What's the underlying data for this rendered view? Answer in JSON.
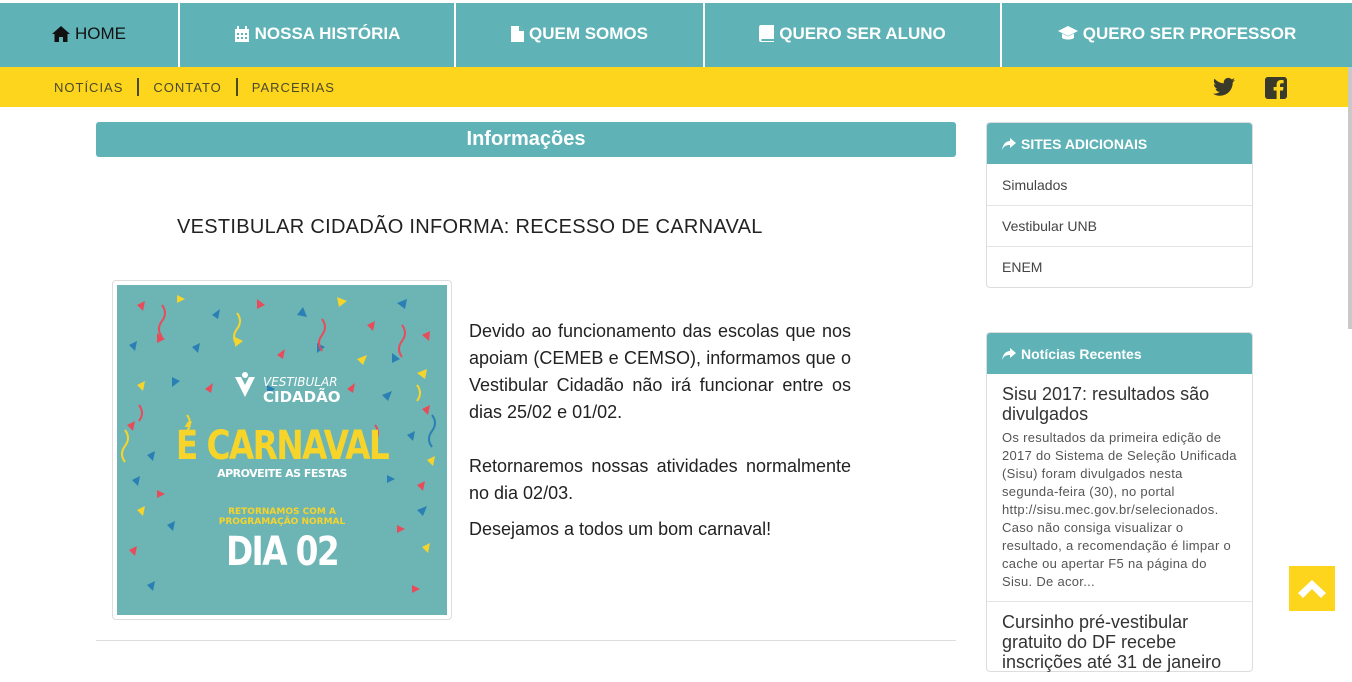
{
  "nav": {
    "items": [
      {
        "label": "HOME",
        "icon": "home-icon"
      },
      {
        "label": "NOSSA HISTÓRIA",
        "icon": "calendar-icon"
      },
      {
        "label": "QUEM SOMOS",
        "icon": "file-icon"
      },
      {
        "label": "QUERO SER ALUNO",
        "icon": "book-icon"
      },
      {
        "label": "QUERO SER PROFESSOR",
        "icon": "graduation-cap-icon"
      }
    ],
    "active": "HOME"
  },
  "subnav": {
    "links": [
      "NOTÍCIAS",
      "CONTATO",
      "PARCERIAS"
    ],
    "social_icons": [
      "twitter-icon",
      "facebook-icon"
    ]
  },
  "main": {
    "section_title": "Informações",
    "post_title": "VESTIBULAR CIDADÃO INFORMA: RECESSO DE CARNAVAL",
    "poster": {
      "logo_top": "VESTIBULAR",
      "logo_bottom": "CIDADÃO",
      "headline": "É CARNAVAL",
      "subline": "APROVEITE AS FESTAS",
      "return_line1": "RETORNAMOS COM A",
      "return_line2": "PROGRAMAÇÃO NORMAL",
      "day": "DIA 02"
    },
    "paragraphs": [
      "Devido ao funcionamento das escolas que nos apoiam (CEMEB e CEMSO), informamos que o Vestibular Cidadão não irá funcionar entre os dias 25/02 e 01/02.",
      "Retornaremos nossas atividades normalmente no dia 02/03.",
      "Desejamos a todos um bom carnaval!"
    ]
  },
  "sidebar": {
    "sites": {
      "title": "SITES ADICIONAIS",
      "links": [
        "Simulados",
        "Vestibular UNB",
        "ENEM"
      ]
    },
    "news": {
      "title": "Notícias Recentes",
      "items": [
        {
          "title": "Sisu 2017: resultados são divulgados",
          "excerpt": "Os resultados da primeira edição de 2017 do Sistema de Seleção Unificada (Sisu) foram divulgados nesta segunda-feira (30), no portal http://sisu.mec.gov.br/selecionados. Caso não consiga visualizar o resultado, a recomendação é limpar o cache ou apertar F5 na página do Sisu. De acor..."
        },
        {
          "title": "Cursinho pré-vestibular gratuito do DF recebe inscrições até 31 de janeiro",
          "excerpt": ""
        }
      ]
    }
  },
  "colors": {
    "teal": "#5fb3b7",
    "yellow": "#fdd51d",
    "poster_bg": "#6cb5b4",
    "poster_yellow": "#f7d42a"
  }
}
